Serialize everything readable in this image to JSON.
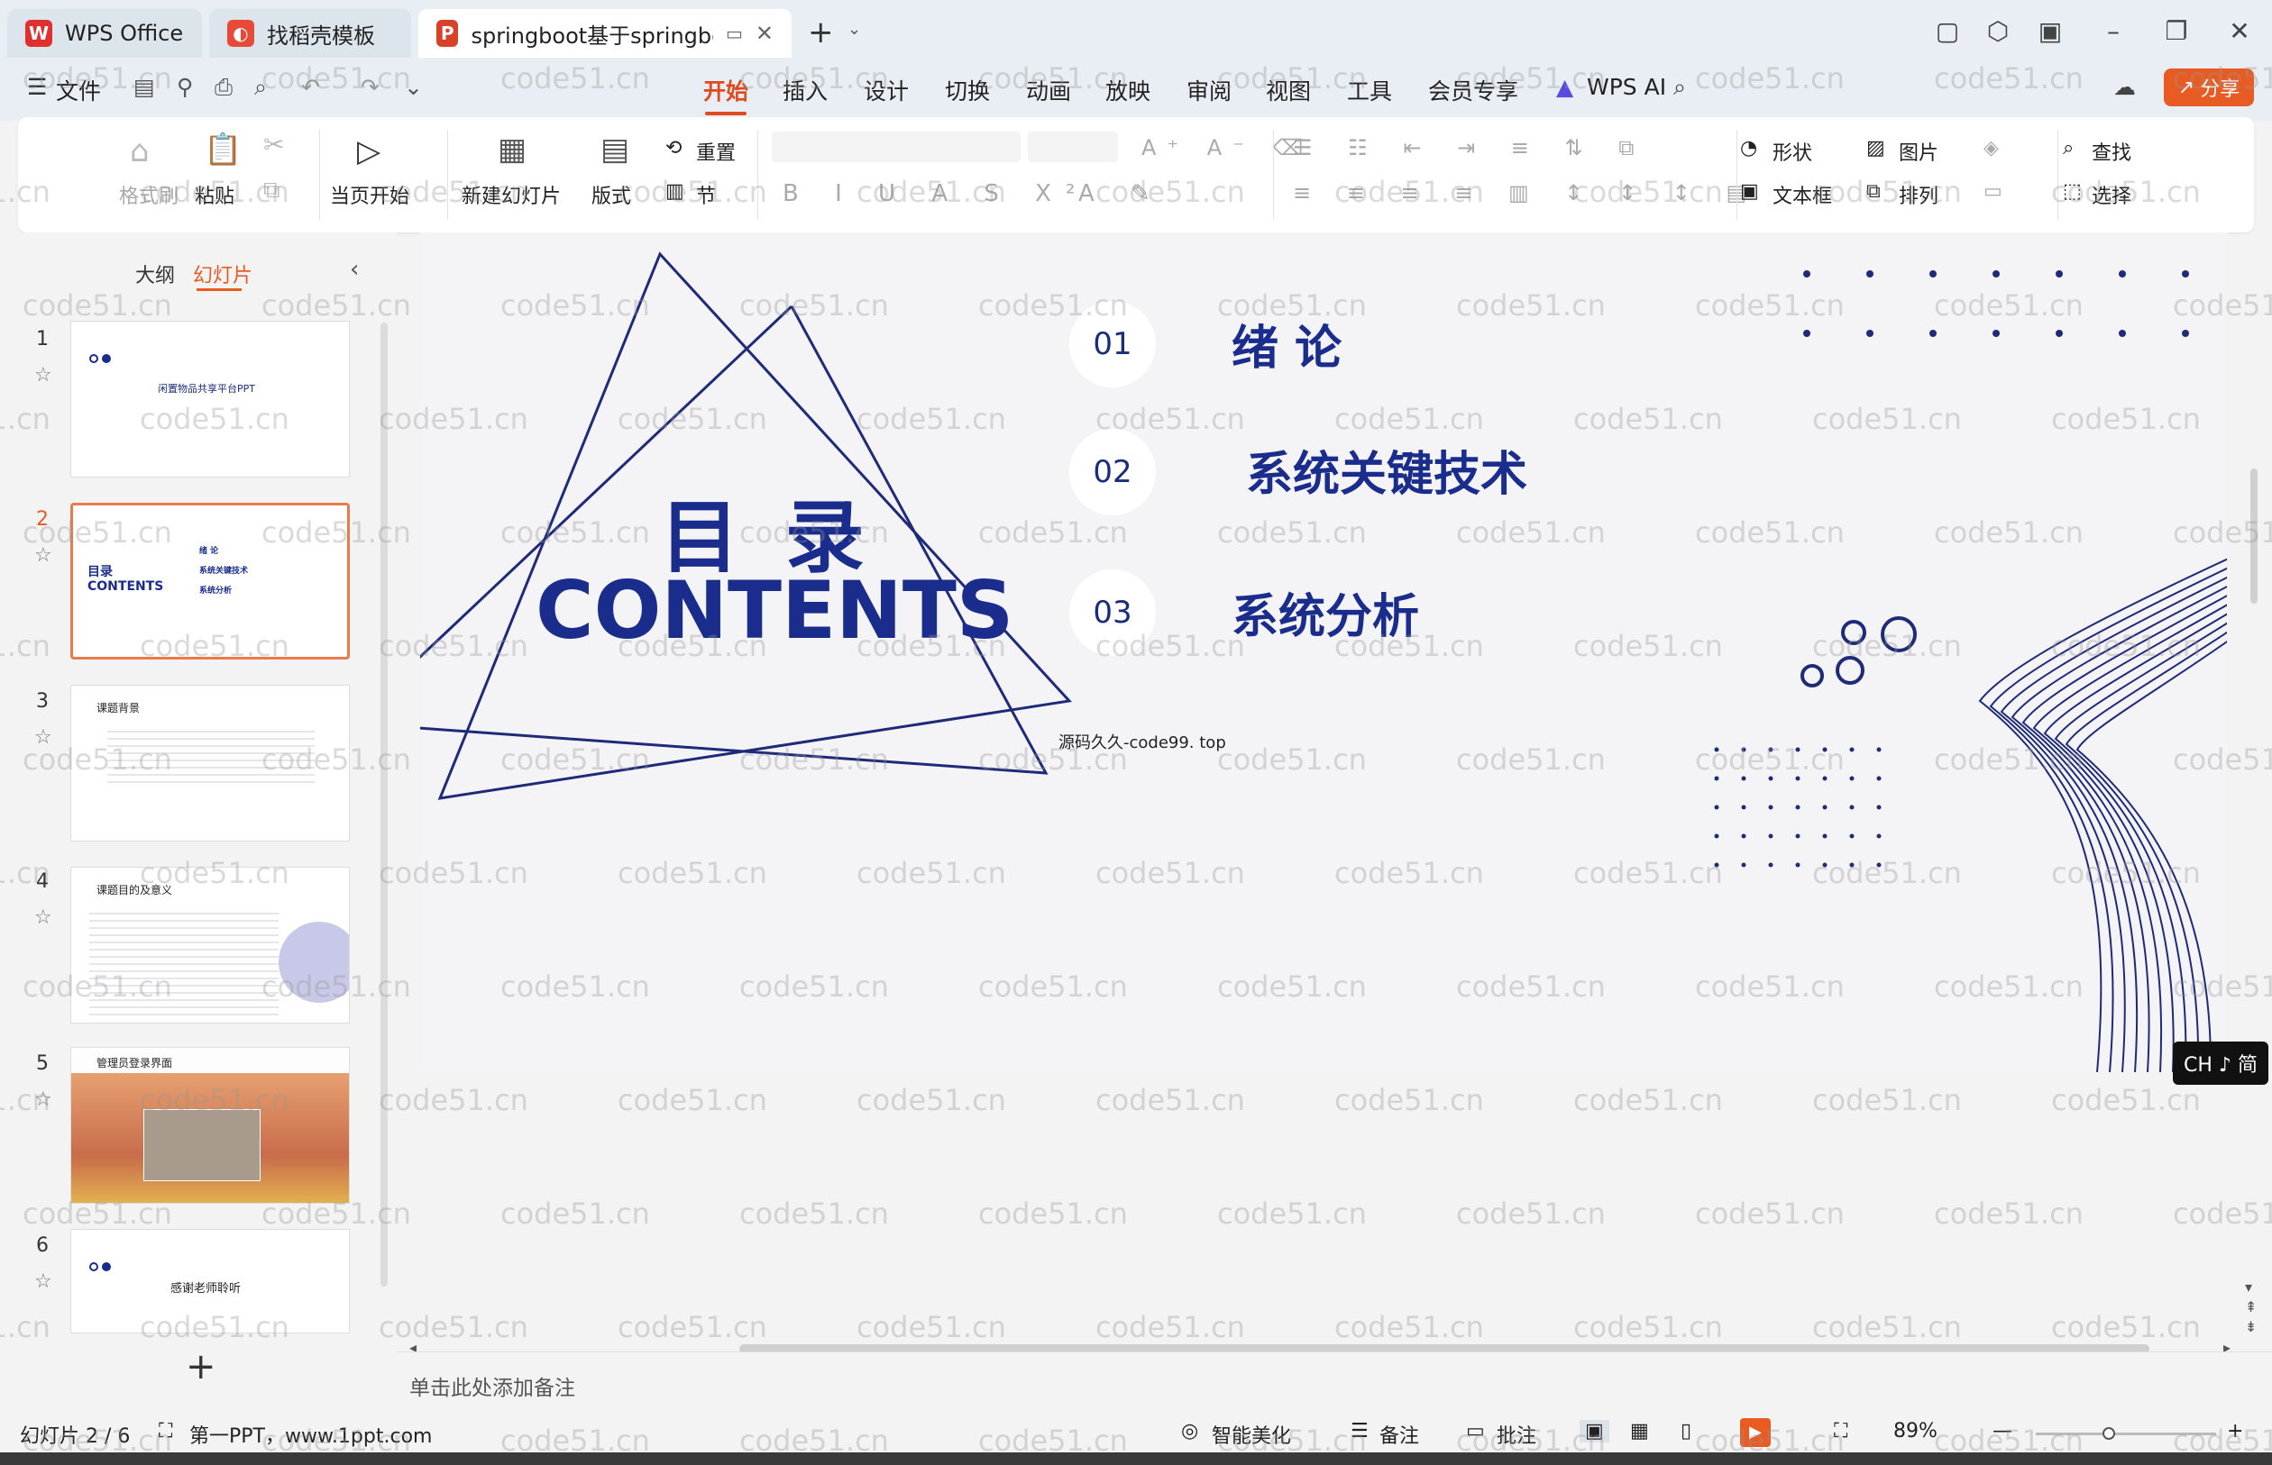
{
  "window": {
    "tabs": [
      {
        "label": "WPS Office",
        "icon": "wps-logo-icon"
      },
      {
        "label": "找稻壳模板",
        "icon": "docer-icon"
      },
      {
        "label": "springboot基于springboot闲",
        "icon": "ppt-icon"
      }
    ],
    "new_tab_label": "+"
  },
  "menubar": {
    "file_label": "文件",
    "tabs": [
      "开始",
      "插入",
      "设计",
      "切换",
      "动画",
      "放映",
      "审阅",
      "视图",
      "工具",
      "会员专享"
    ],
    "active_tab": "开始",
    "wps_ai_label": "WPS AI",
    "share_label": "分享"
  },
  "ribbon": {
    "format_painter": "格式刷",
    "paste": "粘贴",
    "play_current": "当页开始",
    "new_slide": "新建幻灯片",
    "layout": "版式",
    "section": "节",
    "reset": "重置",
    "shape": "形状",
    "picture": "图片",
    "textbox": "文本框",
    "arrange": "排列",
    "find": "查找",
    "select": "选择"
  },
  "left_panel": {
    "outline_tab": "大纲",
    "slides_tab": "幻灯片",
    "slides": [
      {
        "number": "1",
        "text": "闲置物品共享平台PPT"
      },
      {
        "number": "2",
        "text": "目录 CONTENTS"
      },
      {
        "number": "3",
        "text": "课题背景"
      },
      {
        "number": "4",
        "text": "课题目的及意义"
      },
      {
        "number": "5",
        "text": "管理员登录界面"
      },
      {
        "number": "6",
        "text": "感谢老师聆听"
      }
    ],
    "add_label": "+"
  },
  "slide": {
    "title_cn": "目 录",
    "title_en": "CONTENTS",
    "items": [
      {
        "number": "01",
        "title": "绪  论"
      },
      {
        "number": "02",
        "title": "系统关键技术"
      },
      {
        "number": "03",
        "title": "系统分析"
      }
    ],
    "caption": "源码久久-code99. top",
    "primary_color": "#1a2d8c"
  },
  "notes_placeholder": "单击此处添加备注",
  "statusbar": {
    "slide_counter": "幻灯片 2 / 6",
    "theme": "第一PPT，www.1ppt.com",
    "beautify": "智能美化",
    "notes": "备注",
    "comments": "批注",
    "zoom": "89%"
  },
  "ime": "CH ♪ 简",
  "watermark": "code51.cn"
}
